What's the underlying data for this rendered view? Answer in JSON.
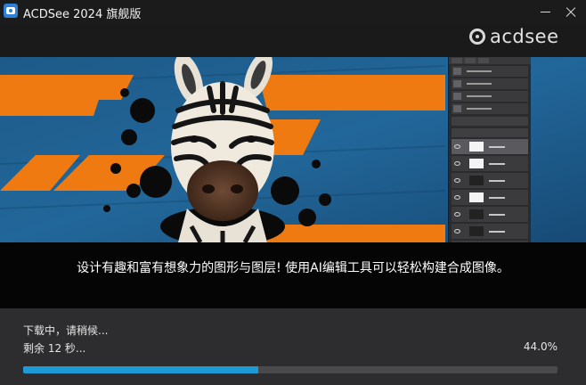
{
  "window": {
    "title": "ACDSee 2024 旗舰版",
    "minimize_icon": "minimize-icon",
    "close_icon": "close-icon"
  },
  "brand": {
    "logo_text": "acdsee",
    "logo_icon": "acdsee-logo-icon"
  },
  "banner": {
    "image": "zebra-collage-photo",
    "colors": {
      "orange": "#f07a12",
      "blue": "#1f5f8f",
      "dark_blue": "#163f63"
    }
  },
  "caption": {
    "text": "设计有趣和富有想象力的图形与图层! 使用AI编辑工具可以轻松构建合成图像。"
  },
  "progress": {
    "status": "下载中，请稍候...",
    "remaining": "剩余 12 秒...",
    "percent_label": "44.0%",
    "fraction": 0.44,
    "fill_color": "#1e9ad6"
  }
}
